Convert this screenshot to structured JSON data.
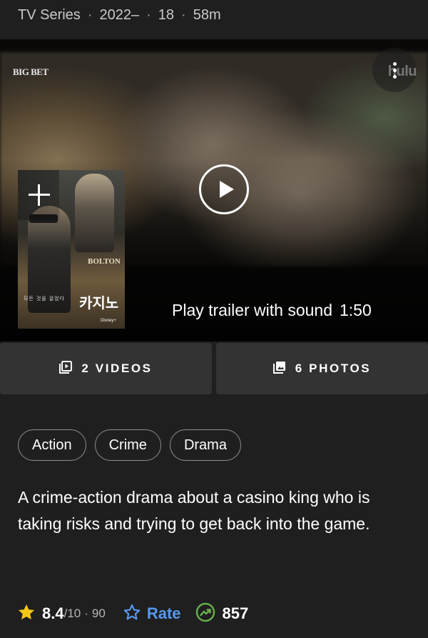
{
  "meta": {
    "type": "TV Series",
    "years": "2022–",
    "rating": "18",
    "runtime": "58m"
  },
  "hero": {
    "left_logo": "BIG BET",
    "right_logo": "hulu",
    "trailer_label": "Play trailer with sound",
    "trailer_duration": "1:50",
    "poster": {
      "brand": "BOLTON",
      "title": "카지노",
      "tagline": "모든 것을 걸었다"
    }
  },
  "media": {
    "videos_label": "2 VIDEOS",
    "photos_label": "6 PHOTOS"
  },
  "genres": [
    "Action",
    "Crime",
    "Drama"
  ],
  "plot": "A crime-action drama about a casino king who is taking risks and trying to get back into the game.",
  "ratings": {
    "score": "8.4",
    "out_of": "/10",
    "votes": "90",
    "rate_label": "Rate",
    "popularity": "857"
  },
  "colors": {
    "star": "#f5c518",
    "rate": "#5799ef",
    "popularity": "#67ad4b",
    "background": "#1f1f1f"
  },
  "icons": [
    "video-icon",
    "photo-icon",
    "star-icon",
    "star-outline-icon",
    "trending-up-icon",
    "play-icon",
    "more-vertical-icon",
    "add-icon"
  ]
}
